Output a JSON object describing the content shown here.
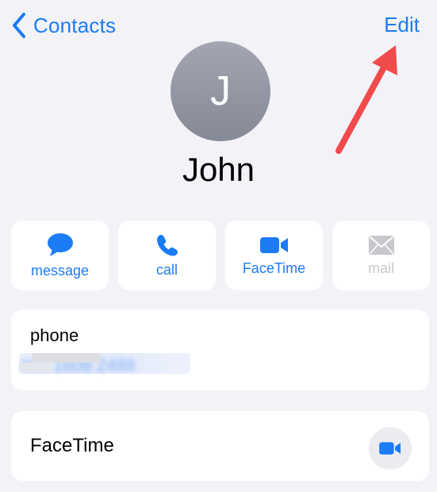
{
  "nav": {
    "back_label": "Contacts",
    "edit_label": "Edit"
  },
  "contact": {
    "initial": "J",
    "name": "John"
  },
  "actions": [
    {
      "label": "message",
      "icon": "message-bubble-icon",
      "enabled": true
    },
    {
      "label": "call",
      "icon": "phone-icon",
      "enabled": true
    },
    {
      "label": "FaceTime",
      "icon": "video-camera-icon",
      "enabled": true
    },
    {
      "label": "mail",
      "icon": "envelope-icon",
      "enabled": false
    }
  ],
  "phone": {
    "label": "phone",
    "number": "400 1608 2488"
  },
  "facetime": {
    "label": "FaceTime",
    "icon": "video-camera-icon"
  },
  "colors": {
    "accent": "#1b7cf5",
    "background": "#f2f2f7",
    "disabled": "#c7c7cc",
    "annotation_arrow": "#f04a4a"
  }
}
